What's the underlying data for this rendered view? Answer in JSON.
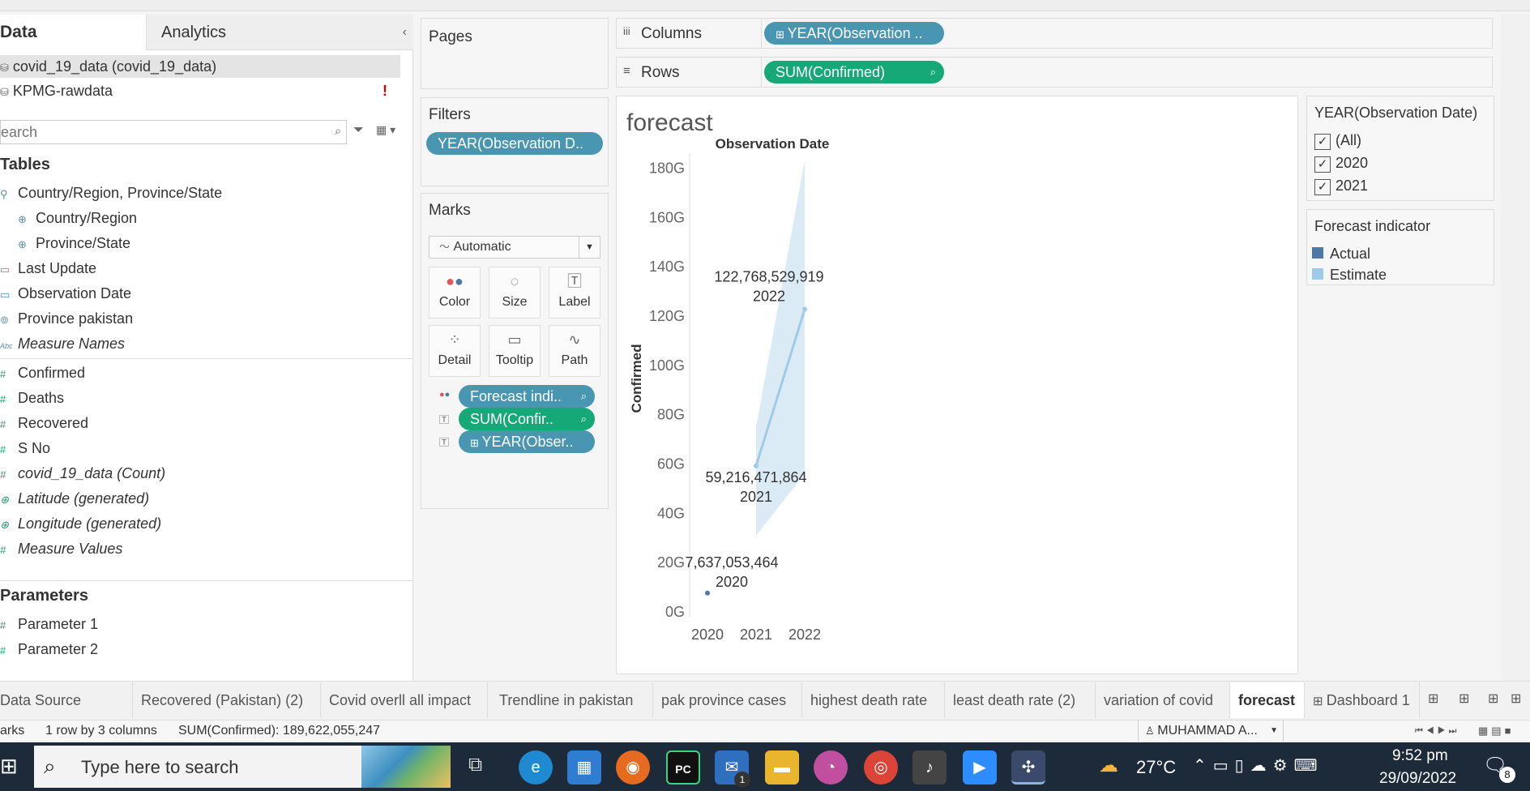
{
  "left_panel": {
    "tab_data": "Data",
    "tab_analytics": "Analytics",
    "sources": [
      {
        "label": "covid_19_data (covid_19_data)"
      },
      {
        "label": "KPMG-rawdata"
      }
    ],
    "warning_mark": "!",
    "search_placeholder": "earch",
    "tables_header": "Tables",
    "dimensions": [
      {
        "label": "Country/Region, Province/State",
        "icon": "hierarchy-icon"
      },
      {
        "label": "Country/Region",
        "icon": "globe-icon"
      },
      {
        "label": "Province/State",
        "icon": "globe-icon"
      },
      {
        "label": "Last Update",
        "icon": "calendar-icon"
      },
      {
        "label": "Observation Date",
        "icon": "calendar-icon"
      },
      {
        "label": "Province pakistan",
        "icon": "set-icon"
      },
      {
        "label": "Measure Names",
        "icon": "abc-icon"
      }
    ],
    "measures": [
      {
        "label": "Confirmed"
      },
      {
        "label": "Deaths"
      },
      {
        "label": "Recovered"
      },
      {
        "label": "S No"
      },
      {
        "label": "covid_19_data (Count)"
      },
      {
        "label": "Latitude (generated)"
      },
      {
        "label": "Longitude (generated)"
      },
      {
        "label": "Measure Values"
      }
    ],
    "parameters_header": "Parameters",
    "parameters": [
      {
        "label": "Parameter 1"
      },
      {
        "label": "Parameter 2"
      }
    ]
  },
  "cards": {
    "pages_title": "Pages",
    "filters_title": "Filters",
    "filter_pill": "YEAR(Observation D..",
    "marks_title": "Marks",
    "mark_type": "Automatic",
    "mark_buttons": [
      "Color",
      "Size",
      "Label",
      "Detail",
      "Tooltip",
      "Path"
    ],
    "mark_pills": [
      {
        "label": "Forecast indi..",
        "color": "blue"
      },
      {
        "label": "SUM(Confir..",
        "color": "green"
      },
      {
        "label": "YEAR(Obser..",
        "color": "blue"
      }
    ]
  },
  "shelves": {
    "columns_label": "Columns",
    "columns_pill": "YEAR(Observation ..",
    "rows_label": "Rows",
    "rows_pill": "SUM(Confirmed)"
  },
  "view": {
    "title": "forecast"
  },
  "chart_data": {
    "type": "line",
    "title": "forecast",
    "xlabel": "Observation Date",
    "ylabel": "Confirmed",
    "categories": [
      "2020",
      "2021",
      "2022"
    ],
    "y_ticks": [
      "0G",
      "20G",
      "40G",
      "60G",
      "80G",
      "100G",
      "120G",
      "140G",
      "160G",
      "180G"
    ],
    "ylim": [
      0,
      190000000000
    ],
    "series": [
      {
        "name": "Actual",
        "color": "#4e79a7",
        "points": [
          {
            "x": "2020",
            "y": 7637053464
          }
        ]
      },
      {
        "name": "Estimate",
        "color": "#a0cbe8",
        "points": [
          {
            "x": "2021",
            "y": 59216471864
          },
          {
            "x": "2022",
            "y": 122768529919
          }
        ]
      }
    ],
    "band": {
      "x": [
        "2021",
        "2022"
      ],
      "lower": [
        31000000000,
        56000000000
      ],
      "upper": [
        75000000000,
        183000000000
      ]
    },
    "labels": [
      {
        "value": "7,637,053,464",
        "year": "2020"
      },
      {
        "value": "59,216,471,864",
        "year": "2021"
      },
      {
        "value": "122,768,529,919",
        "year": "2022"
      }
    ]
  },
  "legend_filter": {
    "title": "YEAR(Observation Date)",
    "items": [
      "(All)",
      "2020",
      "2021"
    ]
  },
  "legend_color": {
    "title": "Forecast indicator",
    "items": [
      {
        "label": "Actual",
        "color": "#4e79a7"
      },
      {
        "label": "Estimate",
        "color": "#a0cbe8"
      }
    ]
  },
  "sheet_tabs": [
    "Data Source",
    "Recovered (Pakistan) (2)",
    "Covid overll all impact",
    "Trendline in pakistan",
    "pak province cases",
    "highest death rate",
    "least  death rate (2)",
    "variation of covid",
    "forecast",
    "Dashboard 1"
  ],
  "status_bar": {
    "marks": "arks",
    "rows_cols": "1 row by 3 columns",
    "sum": "SUM(Confirmed): 189,622,055,247",
    "user": "MUHAMMAD A..."
  },
  "taskbar": {
    "search_placeholder": "Type here to search",
    "temperature": "27°C",
    "time": "9:52 pm",
    "date": "29/09/2022",
    "notifications": "8",
    "mail_badge": "1"
  }
}
